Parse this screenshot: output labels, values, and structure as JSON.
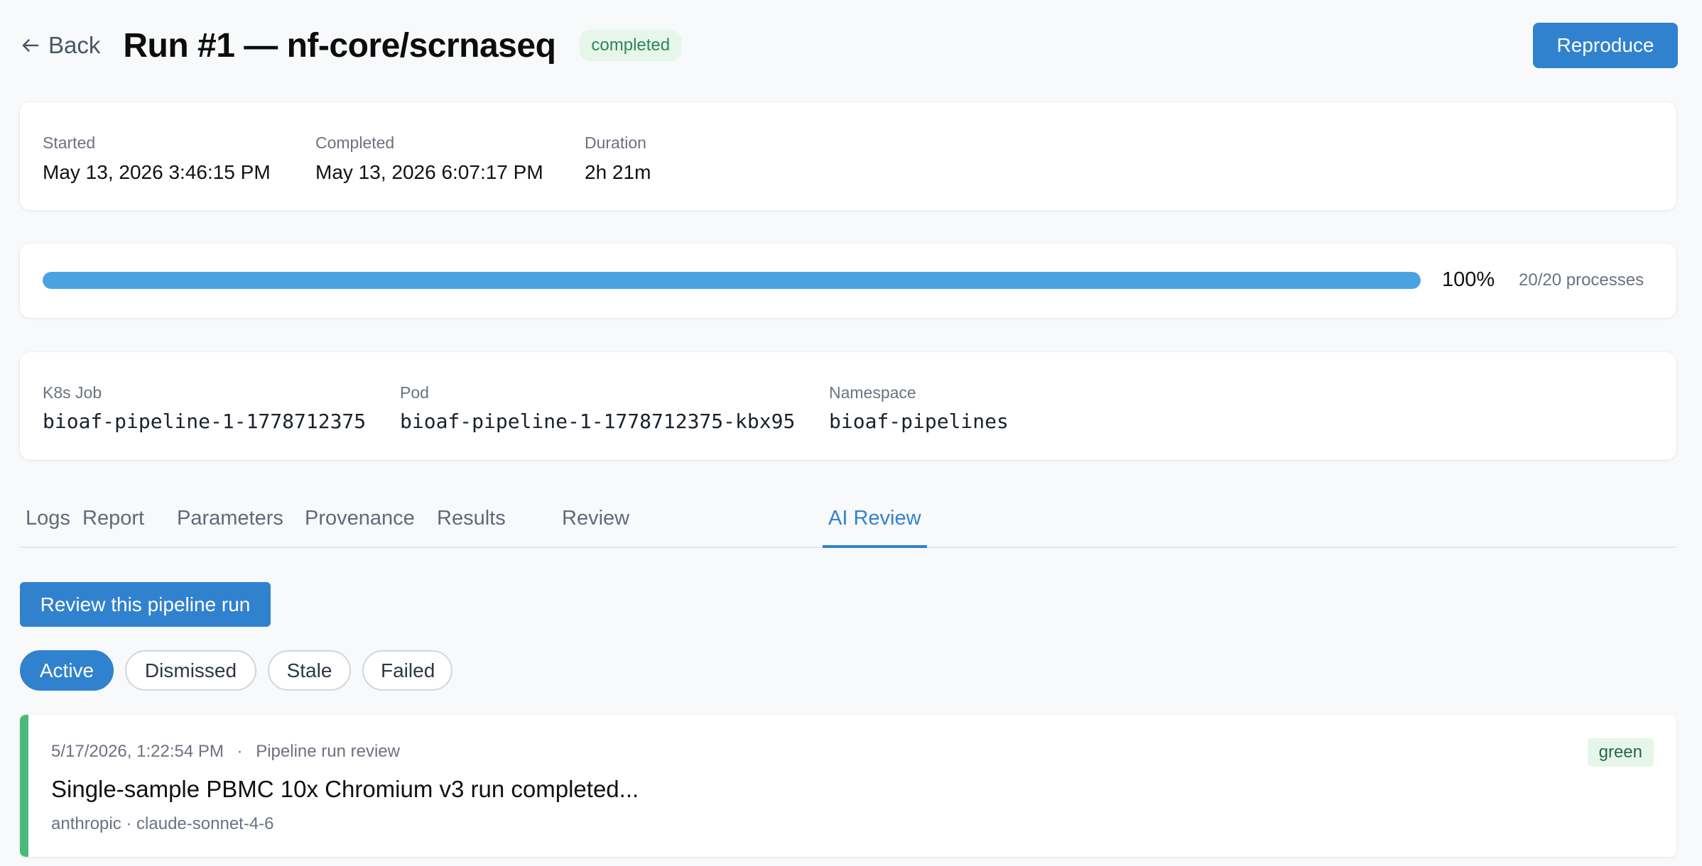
{
  "header": {
    "back_label": "Back",
    "title": "Run #1 — nf-core/scrnaseq",
    "status": "completed",
    "reproduce_label": "Reproduce"
  },
  "timing": {
    "started_label": "Started",
    "started_value": "May 13, 2026 3:46:15 PM",
    "completed_label": "Completed",
    "completed_value": "May 13, 2026 6:07:17 PM",
    "duration_label": "Duration",
    "duration_value": "2h 21m"
  },
  "progress": {
    "percent_label": "100%",
    "fraction": 1.0,
    "processes_label": "20/20 processes"
  },
  "k8s": {
    "job_label": "K8s Job",
    "job_value": "bioaf-pipeline-1-1778712375",
    "pod_label": "Pod",
    "pod_value": "bioaf-pipeline-1-1778712375-kbx95",
    "namespace_label": "Namespace",
    "namespace_value": "bioaf-pipelines"
  },
  "tabs": [
    {
      "label": "Logs"
    },
    {
      "label": "Report"
    },
    {
      "label": "Parameters"
    },
    {
      "label": "Provenance"
    },
    {
      "label": "Results"
    },
    {
      "label": "Review"
    },
    {
      "label": "AI Review",
      "active": true
    }
  ],
  "ai_review": {
    "review_button_label": "Review this pipeline run",
    "filters": [
      {
        "label": "Active",
        "active": true
      },
      {
        "label": "Dismissed"
      },
      {
        "label": "Stale"
      },
      {
        "label": "Failed"
      }
    ],
    "items": [
      {
        "timestamp": "5/17/2026, 1:22:54 PM",
        "separator": "·",
        "kind": "Pipeline run review",
        "title": "Single-sample PBMC 10x Chromium v3 run completed...",
        "model": "anthropic · claude-sonnet-4-6",
        "verdict": "green",
        "stripe_color": "#48bb78"
      }
    ]
  },
  "colors": {
    "accent": "#3182ce",
    "success": "#48bb78",
    "progress": "#4aa3e0"
  }
}
